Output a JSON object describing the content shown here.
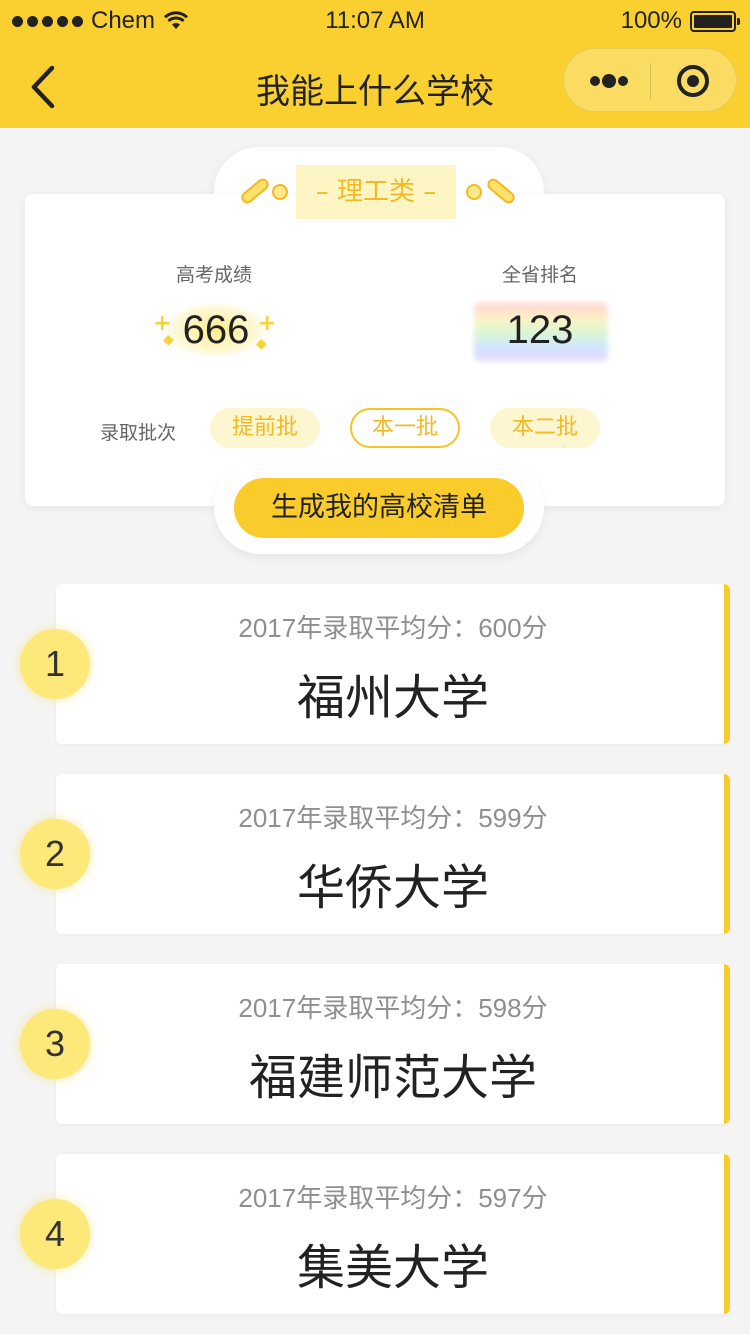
{
  "status_bar": {
    "carrier": "Chem",
    "time": "11:07 AM",
    "battery": "100%"
  },
  "nav": {
    "title": "我能上什么学校"
  },
  "score_card": {
    "category": "– 理工类 –",
    "score_label": "高考成绩",
    "score_value": "666",
    "rank_label": "全省排名",
    "rank_value": "123",
    "batch_label": "录取批次",
    "batches": [
      "提前批",
      "本一批",
      "本二批"
    ],
    "selected_batch": "本一批",
    "generate_button": "生成我的高校清单"
  },
  "schools": [
    {
      "rank": "1",
      "score": "2017年录取平均分：600分",
      "name": "福州大学"
    },
    {
      "rank": "2",
      "score": "2017年录取平均分：599分",
      "name": "华侨大学"
    },
    {
      "rank": "3",
      "score": "2017年录取平均分：598分",
      "name": "福建师范大学"
    },
    {
      "rank": "4",
      "score": "2017年录取平均分：597分",
      "name": "集美大学"
    }
  ],
  "colors": {
    "accent": "#f9d02f",
    "accent_text": "#f2b922",
    "background": "#f4f4f4"
  },
  "icons": {
    "back": "chevron-left-icon",
    "more": "more-dots-icon",
    "close": "target-icon",
    "wifi": "wifi-icon",
    "battery": "battery-icon"
  }
}
